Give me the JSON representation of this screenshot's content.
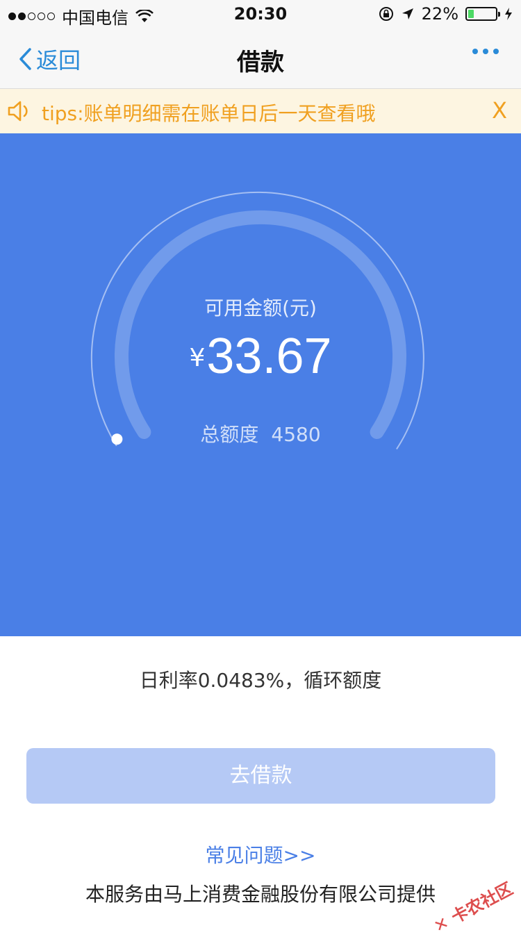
{
  "status_bar": {
    "carrier": "中国电信",
    "time": "20:30",
    "battery_percent": "22%",
    "battery_level": 0.22,
    "signal_bars": 2
  },
  "nav": {
    "back_label": "返回",
    "title": "借款"
  },
  "tips": {
    "text": "tips:账单明细需在账单日后一天查看哦",
    "close_label": "X"
  },
  "hero": {
    "label": "可用金额(元)",
    "currency": "¥",
    "amount": "33.67",
    "total_label": "总额度",
    "total_value": "4580",
    "usage_ratio": 0.0074,
    "color": "#4a7fe6"
  },
  "rate_text": "日利率0.0483%，循环额度",
  "borrow_button": "去借款",
  "faq_link": "常见问题>>",
  "provider_text": "本服务由马上消费金融股份有限公司提供",
  "watermark": "卡农社区"
}
